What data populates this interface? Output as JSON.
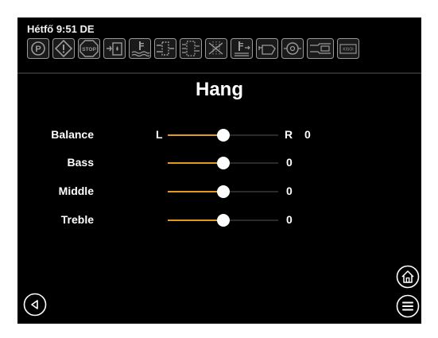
{
  "status": {
    "clock": "Hétfő 9:51 DE"
  },
  "warning_icons": [
    {
      "name": "parking-brake-icon",
      "text": "(P)"
    },
    {
      "name": "general-warning-icon",
      "text": "!"
    },
    {
      "name": "stop-icon",
      "text": "STOP"
    },
    {
      "name": "fuel-water-icon"
    },
    {
      "name": "coolant-temp-icon"
    },
    {
      "name": "hydraulic-filter-icon"
    },
    {
      "name": "transmission-filter-icon"
    },
    {
      "name": "air-filter-restriction-icon"
    },
    {
      "name": "hydraulic-oil-temp-icon"
    },
    {
      "name": "engine-oil-pressure-icon"
    },
    {
      "name": "transmission-oil-pressure-icon"
    },
    {
      "name": "battery-charge-icon"
    },
    {
      "name": "mode-display-icon",
      "text": "KISOI"
    }
  ],
  "page": {
    "title": "Hang"
  },
  "audio": {
    "balance": {
      "label": "Balance",
      "left": "L",
      "right": "R",
      "value": "0",
      "level": 0.5
    },
    "bass": {
      "label": "Bass",
      "value": "0",
      "level": 0.5
    },
    "middle": {
      "label": "Middle",
      "value": "0",
      "level": 0.5
    },
    "treble": {
      "label": "Treble",
      "value": "0",
      "level": 0.5
    }
  },
  "colors": {
    "accent": "#e39a1c",
    "icon_gray": "#9a9a9a",
    "background": "#000000"
  },
  "nav": {
    "back_icon": "back-arrow-icon",
    "home_icon": "home-icon",
    "menu_icon": "menu-icon"
  }
}
